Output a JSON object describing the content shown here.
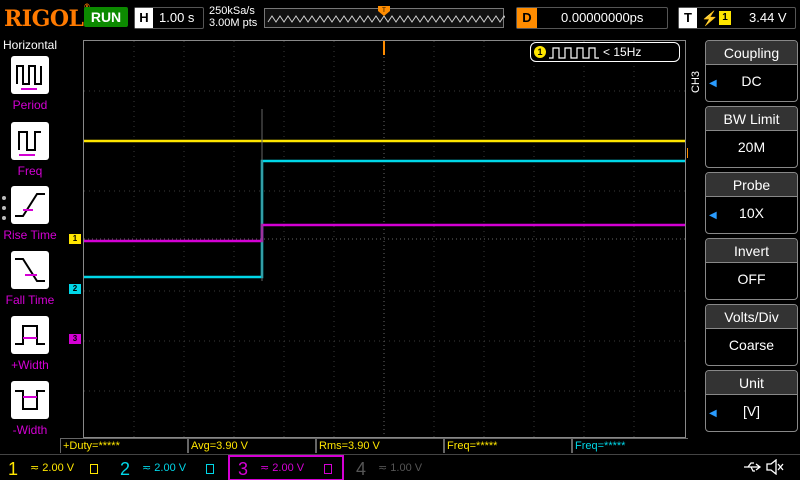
{
  "status": {
    "brand": "RIGOL",
    "run_state": "RUN",
    "timebase_label": "H",
    "timebase": "1.00 s",
    "sample_rate": "250kSa/s",
    "memory_depth": "3.00M pts",
    "delay_label": "D",
    "delay": "0.00000000ps",
    "trigger_label": "T",
    "trigger_source": "1",
    "trigger_level": "3.44 V"
  },
  "horizontal_menu": {
    "title": "Horizontal",
    "items": [
      {
        "label": "Period"
      },
      {
        "label": "Freq"
      },
      {
        "label": "Rise Time"
      },
      {
        "label": "Fall Time"
      },
      {
        "label": "+Width"
      },
      {
        "label": "-Width"
      }
    ]
  },
  "freq_readout": {
    "channel": "1",
    "text": "< 15Hz"
  },
  "channel_markers": {
    "ch1": "1",
    "ch2": "2",
    "ch3": "3",
    "trigger": "T"
  },
  "measurements": [
    {
      "text": "+Duty=*****",
      "color": "yellow"
    },
    {
      "text": "Avg=3.90 V",
      "color": "yellow"
    },
    {
      "text": "Rms=3.90 V",
      "color": "yellow"
    },
    {
      "text": "Freq=*****",
      "color": "yellow"
    },
    {
      "text": "Freq=*****",
      "color": "cyan"
    }
  ],
  "channels": [
    {
      "num": "1",
      "scale": "2.00 V",
      "color": "#ffe600",
      "active": false
    },
    {
      "num": "2",
      "scale": "2.00 V",
      "color": "#00d7e8",
      "active": false
    },
    {
      "num": "3",
      "scale": "2.00 V",
      "color": "#d400d4",
      "active": true
    },
    {
      "num": "4",
      "scale": "1.00 V",
      "color": "#555555",
      "active": false
    }
  ],
  "channel_menu": {
    "channel_label": "CH3",
    "items": [
      {
        "header": "Coupling",
        "value": "DC"
      },
      {
        "header": "BW Limit",
        "value": "20M"
      },
      {
        "header": "Probe",
        "value": "10X"
      },
      {
        "header": "Invert",
        "value": "OFF"
      },
      {
        "header": "Volts/Div",
        "value": "Coarse"
      },
      {
        "header": "Unit",
        "value": "[V]"
      }
    ]
  },
  "icons": {
    "usb": "usb-icon",
    "speaker": "speaker-muted-icon"
  }
}
